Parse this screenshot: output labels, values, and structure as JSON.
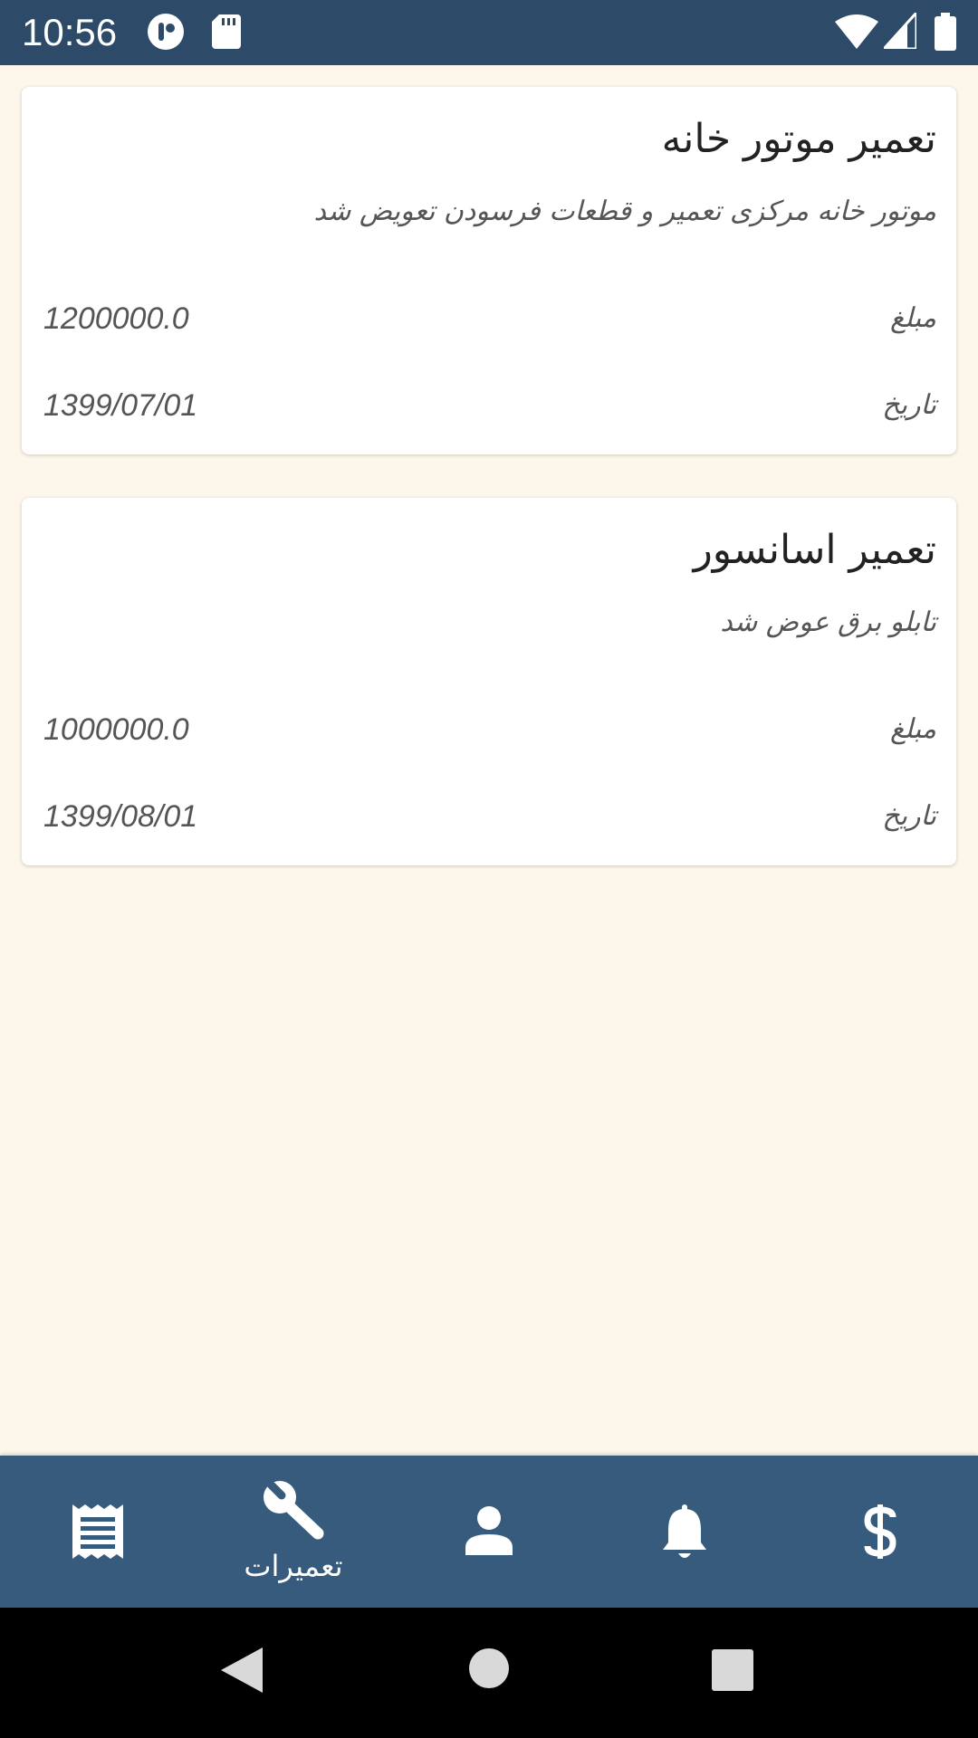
{
  "status_bar": {
    "time": "10:56",
    "icons": [
      "notification-app-icon",
      "sd-card-icon",
      "wifi-icon",
      "signal-icon",
      "battery-icon"
    ]
  },
  "repairs": [
    {
      "title": "تعمیر موتور خانه",
      "description": "موتور خانه مرکزی تعمیر و قطعات فرسودن تعویض شد",
      "amount_label": "مبلغ",
      "amount": "1200000.0",
      "date_label": "تاریخ",
      "date": "1399/07/01"
    },
    {
      "title": "تعمیر اسانسور",
      "description": "تابلو برق عوض شد",
      "amount_label": "مبلغ",
      "amount": "1000000.0",
      "date_label": "تاریخ",
      "date": "1399/08/01"
    }
  ],
  "bottom_nav": {
    "items": [
      {
        "icon": "receipt-icon",
        "label": ""
      },
      {
        "icon": "wrench-icon",
        "label": "تعمیرات",
        "active": true
      },
      {
        "icon": "person-icon",
        "label": ""
      },
      {
        "icon": "bell-icon",
        "label": ""
      },
      {
        "icon": "dollar-icon",
        "label": ""
      }
    ]
  },
  "colors": {
    "status_bar": "#2d4b68",
    "background": "#fdf6ea",
    "nav_bar": "#375b7d",
    "card": "#ffffff"
  }
}
